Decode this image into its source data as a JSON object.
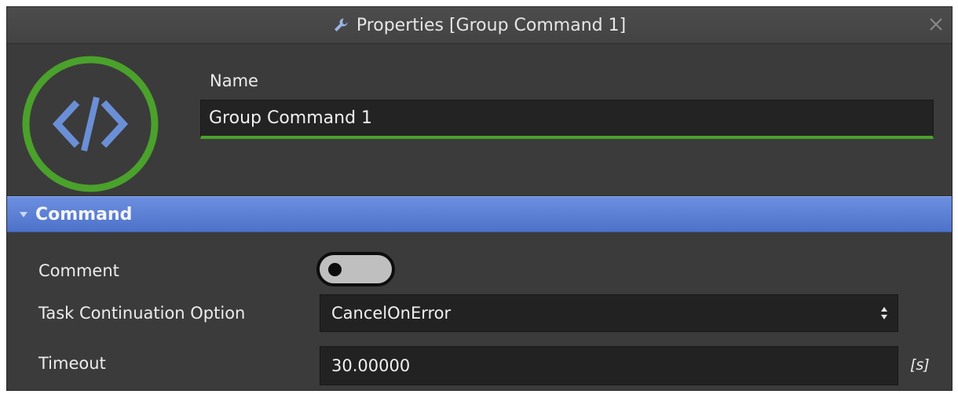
{
  "window": {
    "title": "Properties [Group Command 1]",
    "title_icon": "wrench-icon",
    "close_icon": "close-icon"
  },
  "header": {
    "logo_icon": "code-icon",
    "name_label": "Name",
    "name_value": "Group Command 1"
  },
  "section": {
    "title": "Command",
    "expanded": true
  },
  "properties": {
    "comment": {
      "label": "Comment",
      "enabled": false
    },
    "task_continuation": {
      "label": "Task Continuation Option",
      "value": "CancelOnError"
    },
    "timeout": {
      "label": "Timeout",
      "value": "30.00000",
      "unit": "[s]"
    }
  },
  "colors": {
    "accent_green": "#4aa12b",
    "section_blue": "#5b80d6",
    "logo_blue": "#6b8fd6",
    "panel_bg": "#3b3b3b"
  }
}
